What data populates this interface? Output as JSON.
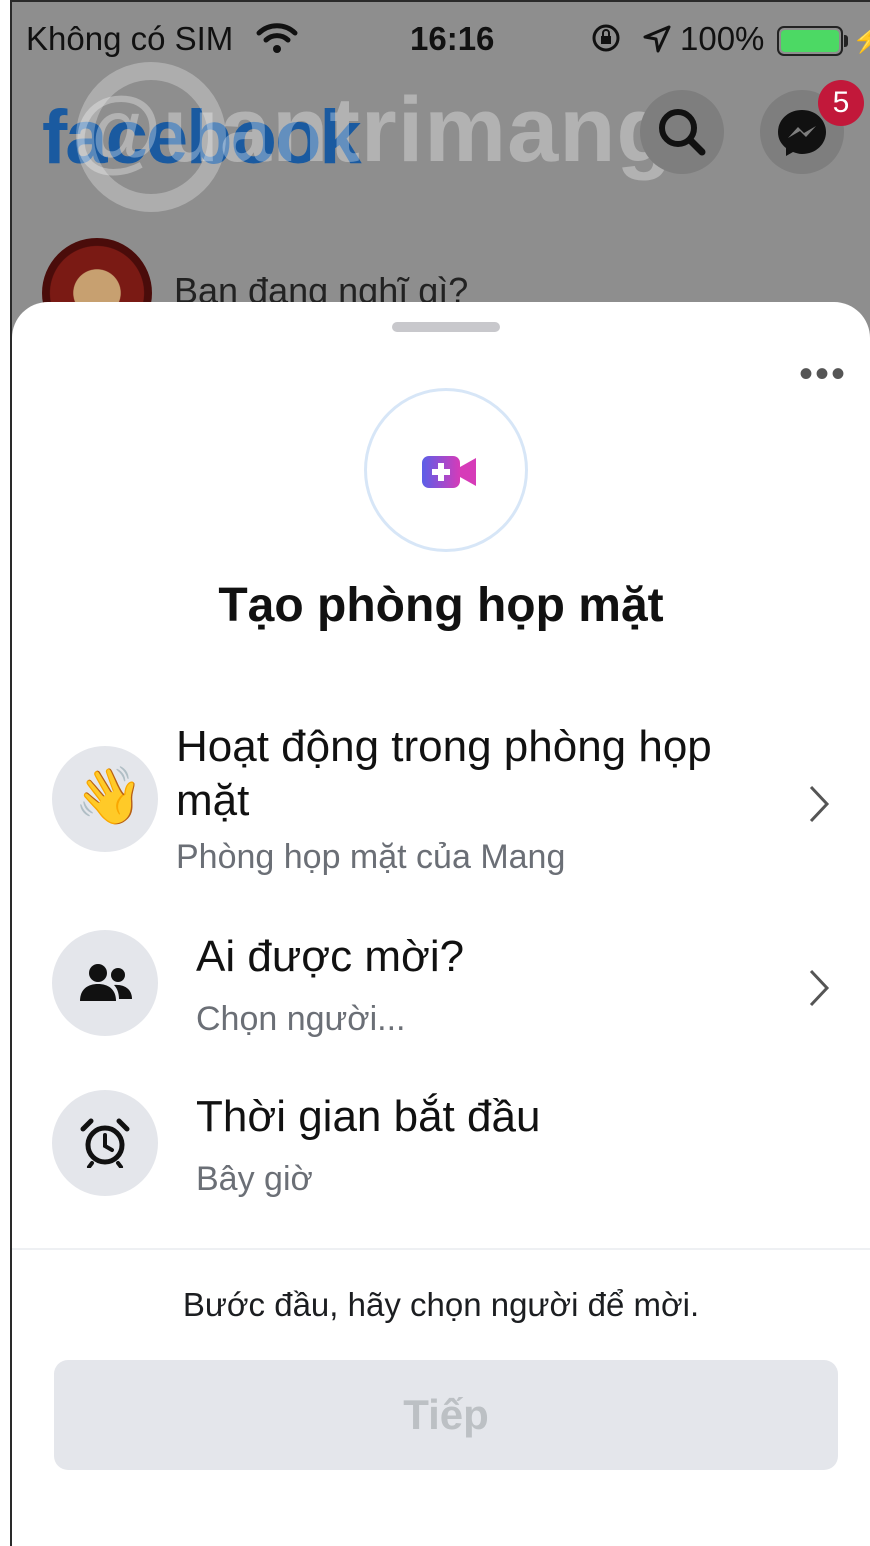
{
  "status_bar": {
    "carrier": "Không có SIM",
    "time": "16:16",
    "battery_percent": "100%",
    "battery_level": 1.0
  },
  "background": {
    "logo": "facebook",
    "watermark": "@uantrimang",
    "composer_placeholder": "Bạn đang nghĩ gì?",
    "messenger_badge": "5",
    "icons": [
      "search-icon",
      "messenger-icon"
    ]
  },
  "sheet": {
    "more_label": "•••",
    "hero_icon": "video-plus-icon",
    "title": "Tạo phòng họp mặt",
    "rows": [
      {
        "icon": "waving-hand-icon",
        "title": "Hoạt động trong phòng họp mặt",
        "subtitle": "Phòng họp mặt của Mang",
        "has_chevron": true
      },
      {
        "icon": "people-icon",
        "title": "Ai được mời?",
        "subtitle": "Chọn người...",
        "has_chevron": true
      },
      {
        "icon": "alarm-clock-icon",
        "title": "Thời gian bắt đầu",
        "subtitle": "Bây giờ",
        "has_chevron": false
      }
    ],
    "hint": "Bước đầu, hãy chọn người để mời.",
    "next_button": "Tiếp"
  },
  "colors": {
    "fb_blue": "#1a5aa0",
    "badge_red": "#c2183a",
    "battery_green": "#4cd964",
    "row_icon_bg": "#e4e6eb",
    "disabled_button_bg": "#e4e6eb",
    "disabled_button_text": "#bcc0c4"
  }
}
